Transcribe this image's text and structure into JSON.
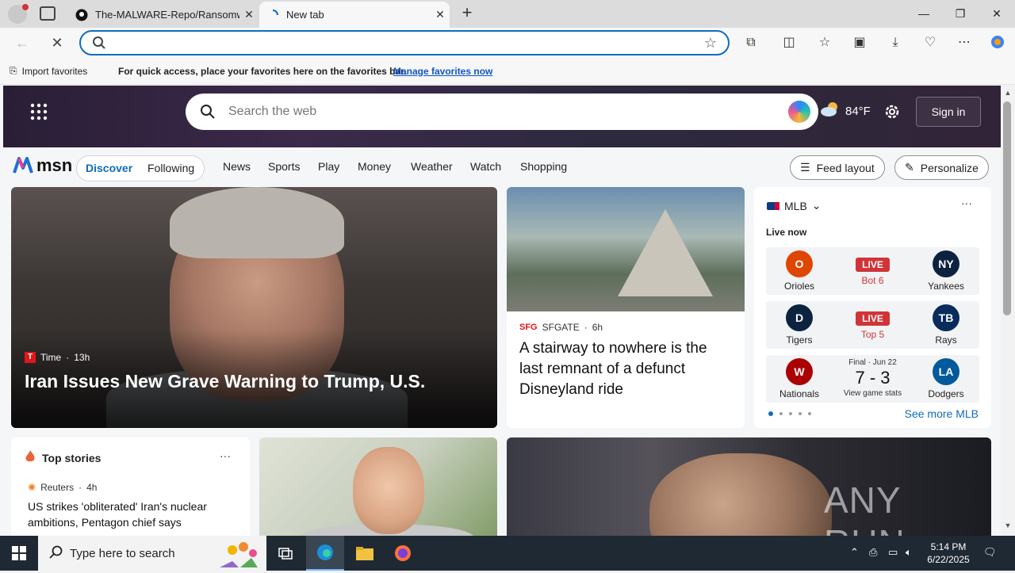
{
  "browser": {
    "tabs": [
      {
        "title": "The-MALWARE-Repo/Ransomwar",
        "icon": "github-icon"
      },
      {
        "title": "New tab",
        "icon": "loading-icon"
      }
    ],
    "address": {
      "value": "",
      "placeholder": ""
    },
    "favorites_bar": {
      "import_label": "Import favorites",
      "message": "For quick access, place your favorites here on the favorites bar.",
      "link": "Manage favorites now"
    }
  },
  "msn": {
    "search_placeholder": "Search the web",
    "weather": {
      "temp": "84°F",
      "icon": "partly-cloudy-icon"
    },
    "sign_in": "Sign in",
    "logo_text": "msn",
    "feed_tabs": [
      "Discover",
      "Following"
    ],
    "nav": [
      "News",
      "Sports",
      "Play",
      "Money",
      "Weather",
      "Watch",
      "Shopping"
    ],
    "feed_layout": "Feed layout",
    "personalize": "Personalize",
    "hero_story": {
      "source": "Time",
      "source_logo": "T",
      "age": "13h",
      "headline": "Iran Issues New Grave Warning to Trump, U.S."
    },
    "side_story": {
      "source": "SFGATE",
      "source_logo": "SFG",
      "age": "6h",
      "headline": "A stairway to nowhere is the last remnant of a defunct Disneyland ride"
    },
    "mlb": {
      "title": "MLB",
      "live_now": "Live now",
      "games": [
        {
          "left": "Orioles",
          "right": "Yankees",
          "status": "LIVE",
          "detail": "Bot 6",
          "left_color": "#df4601",
          "right_color": "#0c2340",
          "left_abbr": "O",
          "right_abbr": "NY"
        },
        {
          "left": "Tigers",
          "right": "Rays",
          "status": "LIVE",
          "detail": "Top 5",
          "left_color": "#0c2340",
          "right_color": "#092c5c",
          "left_abbr": "D",
          "right_abbr": "TB"
        },
        {
          "left": "Nationals",
          "right": "Dodgers",
          "status": "Final · Jun 22",
          "score": "7 - 3",
          "detail": "View game stats",
          "left_color": "#ab0003",
          "right_color": "#005a9c",
          "left_abbr": "W",
          "right_abbr": "LA"
        }
      ],
      "see_more": "See more MLB"
    },
    "top_stories": {
      "title": "Top stories",
      "source": "Reuters",
      "age": "4h",
      "headline": "US strikes 'obliterated' Iran's nuclear ambitions, Pentagon chief says"
    },
    "watermark": "ANY RUN"
  },
  "taskbar": {
    "search_placeholder": "Type here to search",
    "time": "5:14 PM",
    "date": "6/22/2025"
  }
}
